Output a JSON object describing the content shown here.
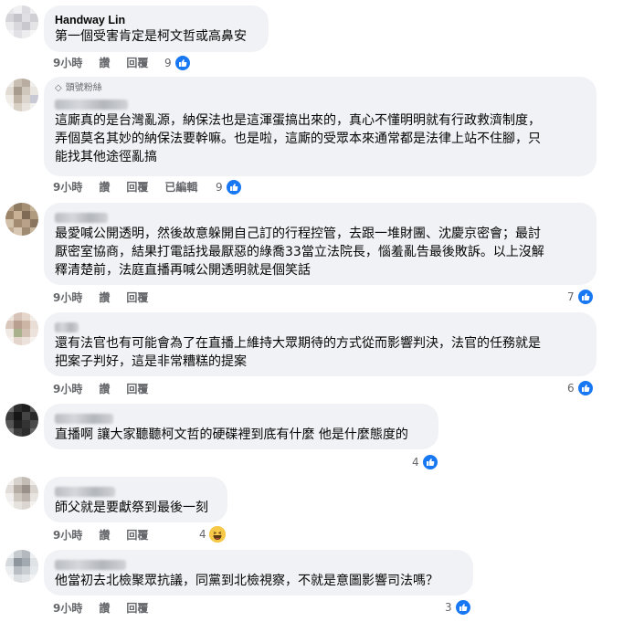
{
  "comments": [
    {
      "author": "Handway Lin",
      "badge": "",
      "text": "第一個受害肯定是柯文哲或高鼻安",
      "time": "9小時",
      "like": "讚",
      "reply": "回覆",
      "edited": "",
      "count": "9",
      "reaction": "like-icon"
    },
    {
      "author": "",
      "badge": "頭號粉絲",
      "text": "這廝真的是台灣亂源，納保法也是這渾蛋搞出來的，真心不懂明明就有行政救濟制度，\n弄個莫名其妙的納保法要幹嘛。也是啦，這廝的受眾本來通常都是法律上站不住腳，只\n能找其他途徑亂搞",
      "time": "9小時",
      "like": "讚",
      "reply": "回覆",
      "edited": "已編輯",
      "count": "9",
      "reaction": "like-icon"
    },
    {
      "author": "",
      "badge": "",
      "text": "最愛喊公開透明，然後故意躲開自己訂的行程控管，去跟一堆財團、沈慶京密會；最討\n厭密室協商，結果打電話找最厭惡的綠喬33當立法院長，惱羞亂告最後敗訴。以上沒解\n釋清楚前，法庭直播再喊公開透明就是個笑話",
      "time": "9小時",
      "like": "讚",
      "reply": "回覆",
      "edited": "",
      "count": "7",
      "reaction": "like-icon"
    },
    {
      "author": "",
      "badge": "",
      "text": "還有法官也有可能會為了在直播上維持大眾期待的方式從而影響判決，法官的任務就是\n把案子判好，這是非常糟糕的提案",
      "time": "9小時",
      "like": "讚",
      "reply": "回覆",
      "edited": "",
      "count": "6",
      "reaction": "like-icon"
    },
    {
      "author": "",
      "badge": "",
      "text": "直播啊 讓大家聽聽柯文哲的硬碟裡到底有什麼 他是什麼態度的",
      "time": "",
      "like": "",
      "reply": "",
      "edited": "",
      "count": "4",
      "reaction": "like-icon"
    },
    {
      "author": "",
      "badge": "",
      "text": "師父就是要獻祭到最後一刻",
      "time": "9小時",
      "like": "讚",
      "reply": "回覆",
      "edited": "",
      "count": "4",
      "reaction": "haha-icon"
    },
    {
      "author": "",
      "badge": "",
      "text": "他當初去北檢聚眾抗議，同黨到北檢視察，不就是意圖影響司法嗎？",
      "time": "9小時",
      "like": "讚",
      "reply": "回覆",
      "edited": "",
      "count": "3",
      "reaction": "like-icon"
    }
  ],
  "colors": {
    "bubble": "#f0f2f5",
    "like": "#1877f2",
    "meta": "#65676b"
  }
}
